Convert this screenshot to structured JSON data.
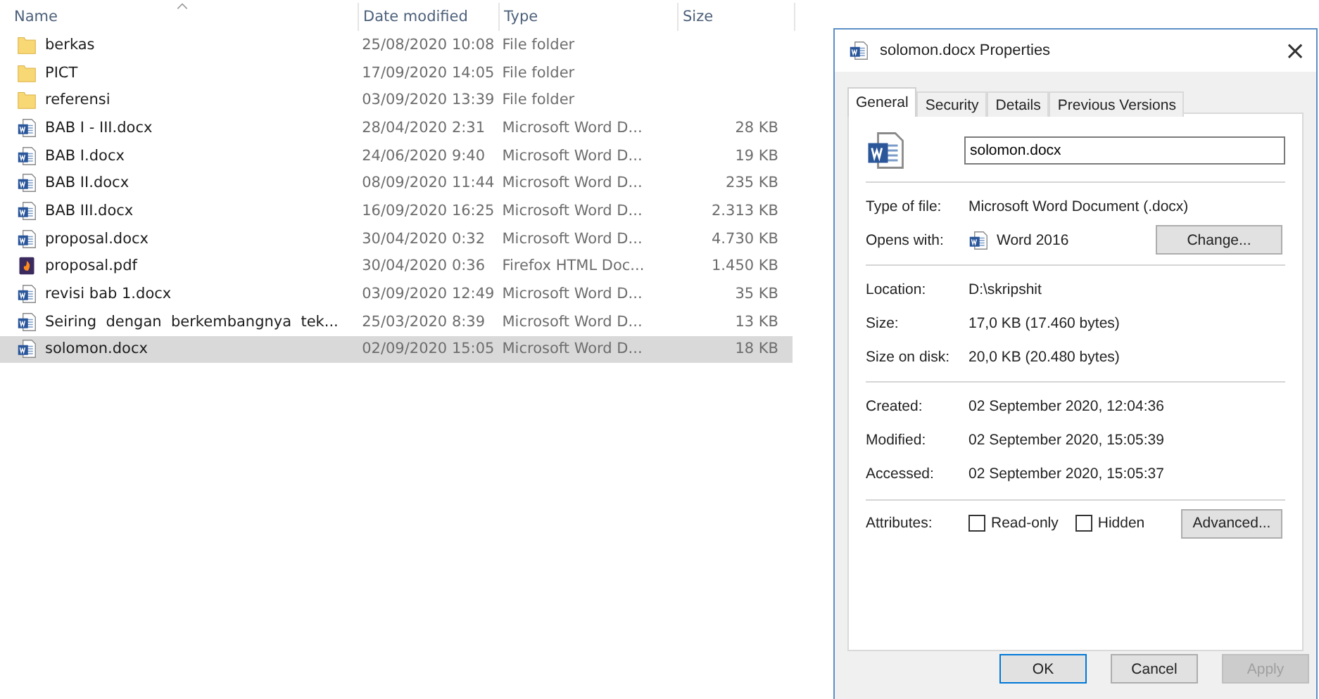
{
  "explorer": {
    "columns": [
      {
        "label": "Name",
        "sorted": true
      },
      {
        "label": "Date modified",
        "sorted": false
      },
      {
        "label": "Type",
        "sorted": false
      },
      {
        "label": "Size",
        "sorted": false
      }
    ],
    "rows": [
      {
        "kind": "folder",
        "name": "berkas",
        "date": "25/08/2020 10:08",
        "type": "File folder",
        "selected": false
      },
      {
        "kind": "folder",
        "name": "PICT",
        "date": "17/09/2020 14:05",
        "type": "File folder",
        "selected": false
      },
      {
        "kind": "folder",
        "name": "referensi",
        "date": "03/09/2020 13:39",
        "type": "File folder",
        "selected": false
      },
      {
        "kind": "word",
        "name": "BAB I - III.docx",
        "date": "28/04/2020 2:31",
        "type": "Microsoft Word D...",
        "size": "28 KB",
        "selected": false
      },
      {
        "kind": "word",
        "name": "BAB I.docx",
        "date": "24/06/2020 9:40",
        "type": "Microsoft Word D...",
        "size": "19 KB",
        "selected": false
      },
      {
        "kind": "word",
        "name": "BAB II.docx",
        "date": "08/09/2020 11:44",
        "type": "Microsoft Word D...",
        "size": "235 KB",
        "selected": false
      },
      {
        "kind": "word",
        "name": "BAB III.docx",
        "date": "16/09/2020 16:25",
        "type": "Microsoft Word D...",
        "size": "2.313 KB",
        "selected": false
      },
      {
        "kind": "word",
        "name": "proposal.docx",
        "date": "30/04/2020 0:32",
        "type": "Microsoft Word D...",
        "size": "4.730 KB",
        "selected": false
      },
      {
        "kind": "pdf",
        "name": "proposal.pdf",
        "date": "30/04/2020 0:36",
        "type": "Firefox HTML Doc...",
        "size": "1.450 KB",
        "selected": false
      },
      {
        "kind": "word",
        "name": "revisi bab 1.docx",
        "date": "03/09/2020 12:49",
        "type": "Microsoft Word D...",
        "size": "35 KB",
        "selected": false
      },
      {
        "kind": "word",
        "name": "Seiring  dengan  berkembangnya  tek...",
        "date": "25/03/2020 8:39",
        "type": "Microsoft Word D...",
        "size": "13 KB",
        "selected": false
      },
      {
        "kind": "word",
        "name": "solomon.docx",
        "date": "02/09/2020 15:05",
        "type": "Microsoft Word D...",
        "size": "18 KB",
        "selected": true
      }
    ]
  },
  "dialog": {
    "title": "solomon.docx Properties",
    "close": "×",
    "tabs": [
      {
        "label": "General",
        "selected": true
      },
      {
        "label": "Security",
        "selected": false
      },
      {
        "label": "Details",
        "selected": false
      },
      {
        "label": "Previous Versions",
        "selected": false
      }
    ],
    "filename": "solomon.docx",
    "type_label": "Type of file:",
    "type_value": "Microsoft Word Document (.docx)",
    "opens_label": "Opens with:",
    "opens_value": "Word 2016",
    "change_button": "Change...",
    "groups": [
      [
        {
          "label": "Location:",
          "value": "D:\\skripshit"
        },
        {
          "label": "Size:",
          "value": "17,0 KB (17.460 bytes)"
        },
        {
          "label": "Size on disk:",
          "value": "20,0 KB (20.480 bytes)"
        }
      ],
      [
        {
          "label": "Created:",
          "value": "02 September 2020, 12:04:36"
        },
        {
          "label": "Modified:",
          "value": "02 September 2020, 15:05:39"
        },
        {
          "label": "Accessed:",
          "value": "02 September 2020, 15:05:37"
        }
      ]
    ],
    "attributes_label": "Attributes:",
    "attributes": [
      {
        "label": "Read-only",
        "checked": false
      },
      {
        "label": "Hidden",
        "checked": false
      }
    ],
    "advanced_button": "Advanced...",
    "buttons": [
      {
        "label": "OK",
        "kind": "default",
        "disabled": false
      },
      {
        "label": "Cancel",
        "kind": "normal",
        "disabled": false
      },
      {
        "label": "Apply",
        "kind": "normal",
        "disabled": true
      }
    ]
  }
}
